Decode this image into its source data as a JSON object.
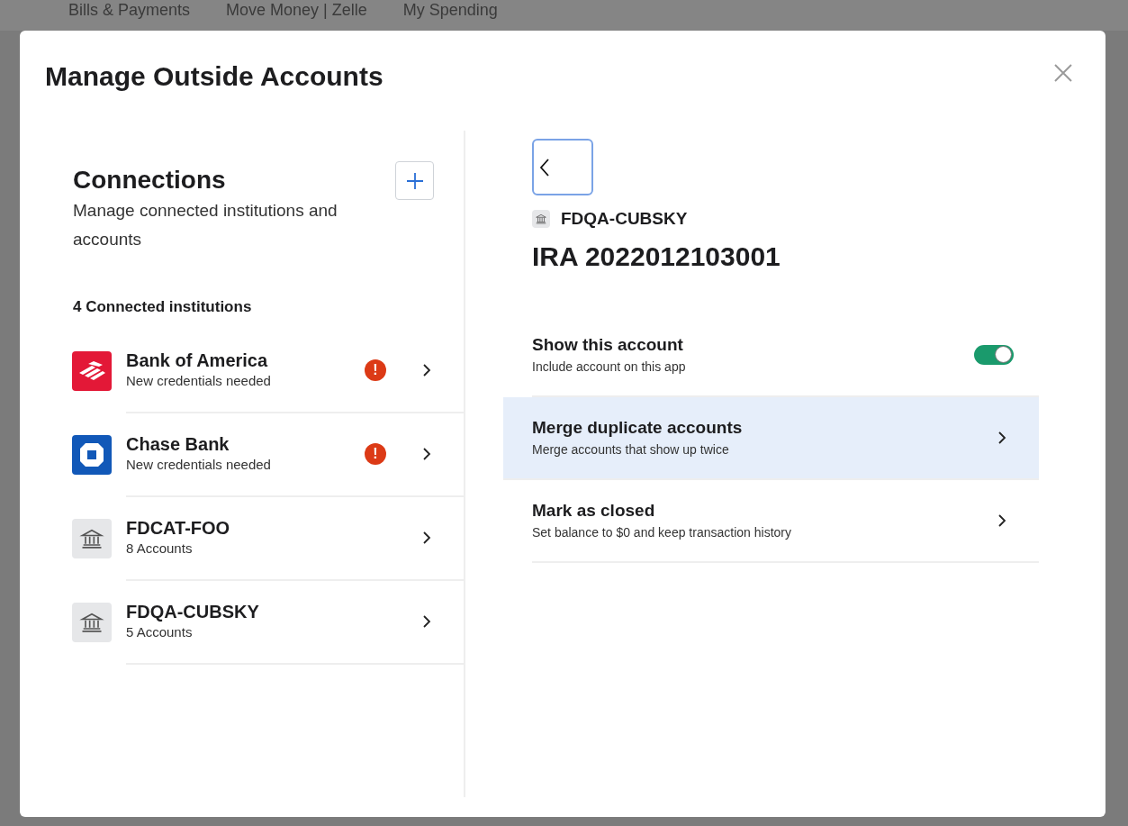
{
  "background_nav": [
    "Bills & Payments",
    "Move Money | Zelle",
    "My Spending"
  ],
  "dialog": {
    "title": "Manage Outside Accounts"
  },
  "connections": {
    "title": "Connections",
    "description": "Manage connected institutions and accounts",
    "count_label": "4 Connected institutions",
    "institutions": [
      {
        "kind": "boa",
        "name": "Bank of America",
        "detail": "New credentials needed",
        "alert": true,
        "alert_mark": "!"
      },
      {
        "kind": "chase",
        "name": "Chase Bank",
        "detail": "New credentials needed",
        "alert": true,
        "alert_mark": "!"
      },
      {
        "kind": "bank",
        "name": "FDCAT-FOO",
        "detail": "8 Accounts",
        "alert": false
      },
      {
        "kind": "bank",
        "name": "FDQA-CUBSKY",
        "detail": "5 Accounts",
        "alert": false
      }
    ]
  },
  "account": {
    "institution": "FDQA-CUBSKY",
    "title": "IRA 2022012103001",
    "options": [
      {
        "kind": "toggle",
        "label": "Show this account",
        "detail": "Include account on this app",
        "on": true
      },
      {
        "kind": "link",
        "label": "Merge duplicate accounts",
        "detail": "Merge accounts that show up twice",
        "selected": true
      },
      {
        "kind": "link",
        "label": "Mark as closed",
        "detail": "Set balance to $0 and keep transaction history",
        "selected": false
      }
    ]
  }
}
